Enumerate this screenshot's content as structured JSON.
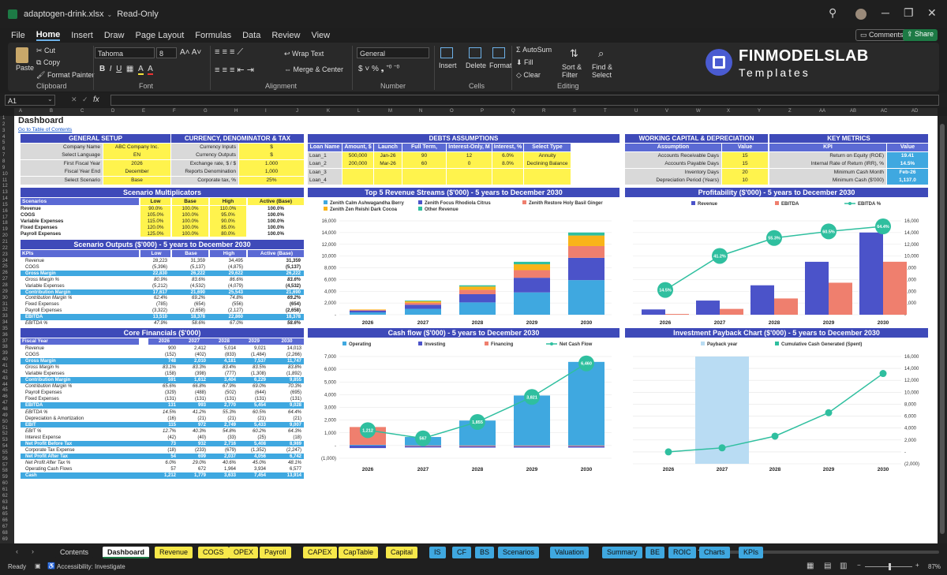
{
  "window": {
    "title": "adaptogen-drink.xlsx",
    "mode": "Read-Only"
  },
  "menu": {
    "items": [
      "File",
      "Home",
      "Insert",
      "Draw",
      "Page Layout",
      "Formulas",
      "Data",
      "Review",
      "View"
    ],
    "active": "Home",
    "comments": "Comments",
    "share": "Share"
  },
  "ribbon": {
    "paste": "Paste",
    "cut": "Cut",
    "copy": "Copy",
    "format_painter": "Format Painter",
    "clipboard": "Clipboard",
    "font_name": "Tahoma",
    "font_size": "8",
    "font": "Font",
    "wrap_text": "Wrap Text",
    "merge_center": "Merge & Center",
    "alignment": "Alignment",
    "number_format": "General",
    "number": "Number",
    "insert": "Insert",
    "delete": "Delete",
    "format": "Format",
    "cells": "Cells",
    "autosum": "AutoSum",
    "fill": "Fill",
    "clear": "Clear",
    "sort_filter": "Sort & Filter",
    "find_select": "Find & Select",
    "editing": "Editing",
    "logo_title": "FINMODELSLAB",
    "logo_sub": "Templates"
  },
  "formula_bar": {
    "cell_ref": "A1",
    "fx": "fx"
  },
  "columns": [
    "A",
    "B",
    "C",
    "D",
    "E",
    "F",
    "G",
    "H",
    "I",
    "J",
    "K",
    "L",
    "M",
    "N",
    "O",
    "P",
    "Q",
    "R",
    "S",
    "T",
    "U",
    "V",
    "W",
    "X",
    "Y",
    "Z",
    "AA",
    "AB",
    "AC",
    "AD"
  ],
  "dashboard": {
    "title": "Dashboard",
    "toc_link": "Go to Table of Contents",
    "general_setup": {
      "title": "GENERAL SETUP",
      "rows": [
        [
          "Company Name",
          "ABC Company Inc."
        ],
        [
          "Select Language",
          "EN"
        ],
        [
          "First Fiscal Year",
          "2026"
        ],
        [
          "Fiscal Year End",
          "December"
        ],
        [
          "Select Scenario",
          "Base"
        ]
      ]
    },
    "currency": {
      "title": "CURRENCY, DENOMINATOR & TAX",
      "rows": [
        [
          "Currency Inputs",
          "$"
        ],
        [
          "Currency Outputs",
          "$"
        ],
        [
          "Exchange rate, $ / $",
          "1.000"
        ],
        [
          "Reports Denomination",
          "1,000"
        ],
        [
          "Corporate tax, %",
          "25%"
        ]
      ]
    },
    "debts": {
      "title": "DEBTS ASSUMPTIONS",
      "headers": [
        "Loan Name",
        "Amount, $",
        "Launch",
        "Full Term, Months",
        "Interest-Only, M",
        "Interest, %",
        "Select Type"
      ],
      "rows": [
        [
          "Loan_1",
          "500,000",
          "Jan-26",
          "90",
          "12",
          "6.0%",
          "Annuity"
        ],
        [
          "Loan_2",
          "200,000",
          "Mar-26",
          "60",
          "0",
          "8.0%",
          "Declining Balance"
        ],
        [
          "Loan_3",
          "",
          "",
          "",
          "",
          "",
          ""
        ],
        [
          "Loan_4",
          "",
          "",
          "",
          "",
          "",
          ""
        ]
      ]
    },
    "working_capital": {
      "title": "WORKING CAPITAL & DEPRECIATION",
      "headers": [
        "Assumption",
        "Value"
      ],
      "rows": [
        [
          "Accounts Receivable Days",
          "15"
        ],
        [
          "Accounts Payable Days",
          "15"
        ],
        [
          "Inventory Days",
          "20"
        ],
        [
          "Depreciation Period (Years)",
          "10"
        ]
      ]
    },
    "key_metrics": {
      "title": "KEY METRICS",
      "headers": [
        "KPI",
        "Value"
      ],
      "rows": [
        [
          "Return on Equity (ROE)",
          "19.41"
        ],
        [
          "Internal Rate of Return (IRR), %",
          "14.5%"
        ],
        [
          "Minimum Cash Month",
          "Feb-26"
        ],
        [
          "Minimum Cash ($'000)",
          "1,137.0"
        ]
      ]
    },
    "scenario_multipliers": {
      "title": "Scenario Multiplicators",
      "headers": [
        "Scenarios",
        "Low",
        "Base",
        "High",
        "Active (Base)"
      ],
      "rows": [
        [
          "Revenue",
          "90.0%",
          "100.0%",
          "110.0%",
          "100.0%"
        ],
        [
          "COGS",
          "105.0%",
          "100.0%",
          "95.0%",
          "100.0%"
        ],
        [
          "Variable Expenses",
          "115.0%",
          "100.0%",
          "90.0%",
          "100.0%"
        ],
        [
          "Fixed Expenses",
          "120.0%",
          "100.0%",
          "85.0%",
          "100.0%"
        ],
        [
          "Payroll Expenses",
          "125.0%",
          "100.0%",
          "80.0%",
          "100.0%"
        ]
      ]
    },
    "scenario_outputs": {
      "title": "Scenario Outputs ($'000) - 5 years to December 2030",
      "headers": [
        "KPIs",
        "Low",
        "Base",
        "High",
        "Active (Base)"
      ],
      "rows": [
        [
          "Revenue",
          "28,223",
          "31,359",
          "34,495",
          "31,359",
          "n"
        ],
        [
          "COGS",
          "(5,396)",
          "(5,137)",
          "(4,875)",
          "(5,137)",
          "n"
        ],
        [
          "Gross Margin",
          "22,830",
          "26,222",
          "29,622",
          "26,222",
          "h"
        ],
        [
          "Gross Margin %",
          "80.9%",
          "83.6%",
          "86.6%",
          "83.6%",
          "i"
        ],
        [
          "Variable Expenses",
          "(5,212)",
          "(4,532)",
          "(4,079)",
          "(4,532)",
          "n"
        ],
        [
          "Contribution Margin",
          "17,617",
          "21,690",
          "25,543",
          "21,690",
          "h"
        ],
        [
          "Contribution Margin %",
          "62.4%",
          "69.2%",
          "74.8%",
          "69.2%",
          "i"
        ],
        [
          "Fixed Expenses",
          "(785)",
          "(654)",
          "(556)",
          "(654)",
          "n"
        ],
        [
          "Payroll Expenses",
          "(3,322)",
          "(2,658)",
          "(2,127)",
          "(2,658)",
          "n"
        ],
        [
          "EBITDA",
          "13,510",
          "18,378",
          "22,860",
          "18,378",
          "h"
        ],
        [
          "EBITDA %",
          "47.9%",
          "58.6%",
          "67.0%",
          "58.6%",
          "i"
        ]
      ]
    },
    "core_financials": {
      "title": "Core Financials ($'000)",
      "headers": [
        "Fiscal Year",
        "2026",
        "2027",
        "2028",
        "2029",
        "2030"
      ],
      "rows": [
        [
          "Revenue",
          "900",
          "2,412",
          "5,014",
          "9,021",
          "14,013",
          "n"
        ],
        [
          "COGS",
          "(152)",
          "(402)",
          "(833)",
          "(1,484)",
          "(2,266)",
          "n"
        ],
        [
          "Gross Margin",
          "748",
          "2,010",
          "4,181",
          "7,537",
          "11,747",
          "h"
        ],
        [
          "Gross Margin %",
          "83.1%",
          "83.3%",
          "83.4%",
          "83.5%",
          "83.8%",
          "i"
        ],
        [
          "Variable Expenses",
          "(158)",
          "(398)",
          "(777)",
          "(1,308)",
          "(1,892)",
          "n"
        ],
        [
          "Contribution Margin",
          "591",
          "1,612",
          "3,404",
          "6,229",
          "9,855",
          "h"
        ],
        [
          "Contribution Margin %",
          "65.6%",
          "66.8%",
          "67.9%",
          "69.0%",
          "70.3%",
          "i"
        ],
        [
          "Payroll Expenses",
          "(329)",
          "(488)",
          "(502)",
          "(644)",
          "(695)",
          "n"
        ],
        [
          "Fixed Expenses",
          "(131)",
          "(131)",
          "(131)",
          "(131)",
          "(131)",
          "n"
        ],
        [
          "EBITDA",
          "131",
          "993",
          "2,770",
          "5,454",
          "9,028",
          "h"
        ],
        [
          "EBITDA %",
          "14.5%",
          "41.2%",
          "55.3%",
          "60.5%",
          "64.4%",
          "i"
        ],
        [
          "Depreciation & Amortization",
          "(16)",
          "(21)",
          "(21)",
          "(21)",
          "(21)",
          "n"
        ],
        [
          "EBIT",
          "115",
          "972",
          "2,749",
          "5,433",
          "9,007",
          "h"
        ],
        [
          "EBIT %",
          "12.7%",
          "40.3%",
          "54.8%",
          "60.2%",
          "64.3%",
          "i"
        ],
        [
          "Interest Expense",
          "(42)",
          "(40)",
          "(33)",
          "(25)",
          "(18)",
          "n"
        ],
        [
          "Net Profit Before Tax",
          "73",
          "932",
          "2,716",
          "5,408",
          "8,989",
          "h"
        ],
        [
          "Corporate Tax Expense",
          "(18)",
          "(233)",
          "(679)",
          "(1,352)",
          "(2,247)",
          "n"
        ],
        [
          "Net Profit After Tax",
          "54",
          "699",
          "2,037",
          "4,056",
          "6,742",
          "h"
        ],
        [
          "Net Profit After Tax %",
          "6.0%",
          "29.0%",
          "40.6%",
          "45.0%",
          "48.1%",
          "i"
        ],
        [
          "Operating Cash Flows",
          "57",
          "672",
          "1,964",
          "3,934",
          "6,577",
          "n"
        ],
        [
          "Cash",
          "1,212",
          "1,779",
          "3,633",
          "7,454",
          "13,914",
          "h"
        ]
      ]
    }
  },
  "chart_data": [
    {
      "type": "bar",
      "title": "Top 5 Revenue Streams ($'000) - 5 years to December 2030",
      "categories": [
        "2026",
        "2027",
        "2028",
        "2029",
        "2030"
      ],
      "stacked": true,
      "ylim": [
        0,
        16000
      ],
      "yticks": [
        "16,000",
        "14,000",
        "12,000",
        "10,000",
        "8,000",
        "6,000",
        "4,000",
        "2,000",
        "-"
      ],
      "series": [
        {
          "name": "Zenith Calm Ashwagandha Berry",
          "color": "#3fa8e0",
          "values": [
            400,
            1000,
            2100,
            3800,
            5900
          ]
        },
        {
          "name": "Zenith Focus Rhodiola Citrus",
          "color": "#4b53c9",
          "values": [
            300,
            700,
            1400,
            2500,
            3800
          ]
        },
        {
          "name": "Zenith Restore Holy Basil Ginger",
          "color": "#ef7f6e",
          "values": [
            120,
            350,
            750,
            1300,
            2000
          ]
        },
        {
          "name": "Zenith Zen Reishi Dark Cocoa",
          "color": "#f9b418",
          "values": [
            80,
            250,
            550,
            1000,
            1800
          ]
        },
        {
          "name": "Other Revenue",
          "color": "#2fbf9f",
          "values": [
            0,
            112,
            214,
            421,
            513
          ]
        }
      ]
    },
    {
      "type": "bar",
      "title": "Profitability ($'000) - 5 years to December 2030",
      "categories": [
        "2026",
        "2027",
        "2028",
        "2029",
        "2030"
      ],
      "ylim": [
        0,
        16000
      ],
      "yticks": [
        "16,000",
        "14,000",
        "12,000",
        "10,000",
        "8,000",
        "6,000",
        "4,000",
        "2,000",
        "-"
      ],
      "series": [
        {
          "name": "Revenue",
          "color": "#4b53c9",
          "values": [
            900,
            2412,
            5014,
            9021,
            14013
          ]
        },
        {
          "name": "EBITDA",
          "color": "#ef7f6e",
          "values": [
            131,
            993,
            2770,
            5454,
            9028
          ]
        },
        {
          "name": "EBITDA %",
          "color": "#2fbf9f",
          "type": "line",
          "values": [
            14.5,
            41.2,
            55.3,
            60.5,
            64.4
          ],
          "labels": [
            "14.5%",
            "41.2%",
            "55.3%",
            "60.5%",
            "64.4%"
          ]
        }
      ]
    },
    {
      "type": "bar",
      "title": "Cash flow ($'000) - 5 years to December 2030",
      "categories": [
        "2026",
        "2027",
        "2028",
        "2029",
        "2030"
      ],
      "ylim": [
        -1000,
        7000
      ],
      "yticks": [
        "7,000",
        "6,000",
        "5,000",
        "4,000",
        "3,000",
        "2,000",
        "1,000",
        "-",
        "(1,000)"
      ],
      "series": [
        {
          "name": "Operating",
          "color": "#3fa8e0",
          "values": [
            57,
            672,
            1964,
            3934,
            6577
          ]
        },
        {
          "name": "Investing",
          "color": "#4b53c9",
          "values": [
            -200,
            -100,
            -100,
            -100,
            -100
          ]
        },
        {
          "name": "Financing",
          "color": "#ef7f6e",
          "values": [
            1400,
            -50,
            -60,
            -60,
            -60
          ]
        },
        {
          "name": "Net Cash Flow",
          "color": "#2fbf9f",
          "type": "line",
          "values": [
            1212,
            567,
            1855,
            3821,
            6460
          ],
          "labels": [
            "1,212",
            "567",
            "1,855",
            "3,821",
            "6,460"
          ]
        }
      ]
    },
    {
      "type": "line",
      "title": "Investment Payback Chart ($'000) - 5 years to December 2030",
      "categories": [
        "2026",
        "2027",
        "2028",
        "2029",
        "2030"
      ],
      "ylim": [
        -2000,
        16000
      ],
      "yticks": [
        "16,000",
        "14,000",
        "12,000",
        "10,000",
        "8,000",
        "6,000",
        "4,000",
        "2,000",
        "-",
        "(2,000)"
      ],
      "series": [
        {
          "name": "Payback year",
          "color": "#b9dcf3",
          "type": "bar",
          "values": [
            0,
            16000,
            0,
            0,
            0
          ]
        },
        {
          "name": "Cumulative Cash Generated (Spent)",
          "color": "#2fbf9f",
          "values": [
            0,
            672,
            2636,
            6570,
            13147
          ]
        }
      ]
    }
  ],
  "sheet_tabs": [
    {
      "label": "Contents",
      "color": "#1f1f1f",
      "fg": "#ddd"
    },
    {
      "label": "Dashboard",
      "color": "#ffffff",
      "fg": "#111",
      "active": true
    },
    {
      "label": "Revenue",
      "color": "#f7e84a"
    },
    {
      "label": "COGS",
      "color": "#f7e84a"
    },
    {
      "label": "OPEX",
      "color": "#f7e84a"
    },
    {
      "label": "Payroll",
      "color": "#f7e84a"
    },
    {
      "label": "CAPEX",
      "color": "#f7e84a"
    },
    {
      "label": "CapTable",
      "color": "#f7e84a"
    },
    {
      "label": "Capital",
      "color": "#f7e84a"
    },
    {
      "label": "IS",
      "color": "#3fa8e0"
    },
    {
      "label": "CF",
      "color": "#3fa8e0"
    },
    {
      "label": "BS",
      "color": "#3fa8e0"
    },
    {
      "label": "Scenarios",
      "color": "#3fa8e0"
    },
    {
      "label": "Valuation",
      "color": "#3fa8e0"
    },
    {
      "label": "Summary",
      "color": "#3fa8e0"
    },
    {
      "label": "BE",
      "color": "#3fa8e0"
    },
    {
      "label": "ROIC",
      "color": "#3fa8e0"
    },
    {
      "label": "Charts",
      "color": "#3fa8e0"
    },
    {
      "label": "KPIs",
      "color": "#3fa8e0"
    }
  ],
  "status": {
    "ready": "Ready",
    "accessibility": "Accessibility: Investigate",
    "zoom": "87%"
  }
}
